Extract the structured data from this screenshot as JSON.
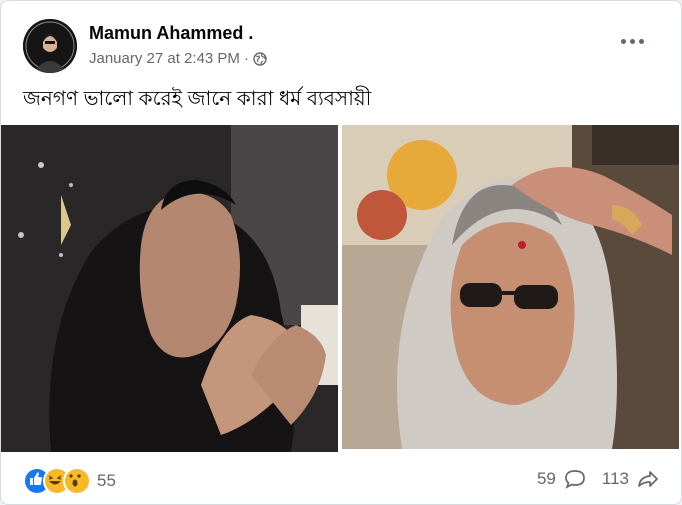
{
  "post": {
    "author": "Mamun Ahammed .",
    "timestamp": "January 27 at 2:43 PM",
    "separator": "·",
    "privacy_icon": "globe-icon",
    "caption": "জনগণ ভালো করেই জানে কারা ধর্ম ব্যবসায়ী"
  },
  "menu": {
    "icon": "more-options-icon"
  },
  "images": {
    "left": "photo-woman-in-black-praying",
    "right": "photo-woman-in-sunglasses-with-tilak"
  },
  "reactions": {
    "icons": [
      "like-icon",
      "haha-icon",
      "wow-icon"
    ],
    "count": "55"
  },
  "engagement": {
    "comments": "59",
    "comment_icon": "comment-icon",
    "shares": "113",
    "share_icon": "share-icon"
  },
  "colors": {
    "like": "#1877f2",
    "emoji": "#f7b928",
    "secondary_text": "#65676b"
  }
}
